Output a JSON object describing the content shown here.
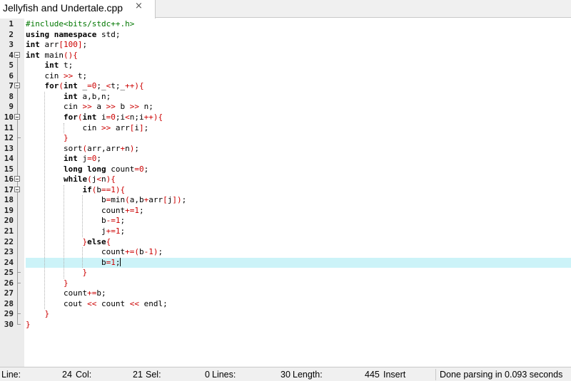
{
  "tab": {
    "title": "Jellyfish and Undertale.cpp",
    "close": "×"
  },
  "editor": {
    "current_line": 24,
    "lines": [
      {
        "n": "1",
        "html": "<span class='pp'>#include&lt;bits/stdc++.h&gt;</span>"
      },
      {
        "n": "2",
        "html": "<span class='kw'>using namespace</span> std;"
      },
      {
        "n": "3",
        "html": "<span class='kw'>int</span> arr<span class='op'>[</span><span class='num'>100</span><span class='op'>]</span>;"
      },
      {
        "n": "4",
        "html": "<span class='kw'>int</span> main<span class='op'>(){</span>"
      },
      {
        "n": "5",
        "html": "    <span class='kw'>int</span> t;"
      },
      {
        "n": "6",
        "html": "    cin <span class='op'>&gt;&gt;</span> t;"
      },
      {
        "n": "7",
        "html": "    <span class='kw'>for</span><span class='op'>(</span><span class='kw'>int</span> _<span class='op'>=</span><span class='num'>0</span>;_<span class='op'>&lt;</span>t;_<span class='op'>++){</span>"
      },
      {
        "n": "8",
        "html": "        <span class='kw'>int</span> a,b,n;"
      },
      {
        "n": "9",
        "html": "        cin <span class='op'>&gt;&gt;</span> a <span class='op'>&gt;&gt;</span> b <span class='op'>&gt;&gt;</span> n;"
      },
      {
        "n": "10",
        "html": "        <span class='kw'>for</span><span class='op'>(</span><span class='kw'>int</span> i<span class='op'>=</span><span class='num'>0</span>;i<span class='op'>&lt;</span>n;i<span class='op'>++){</span>"
      },
      {
        "n": "11",
        "html": "            cin <span class='op'>&gt;&gt;</span> arr<span class='op'>[</span>i<span class='op'>]</span>;"
      },
      {
        "n": "12",
        "html": "        <span class='op'>}</span>"
      },
      {
        "n": "13",
        "html": "        sort<span class='op'>(</span>arr,arr<span class='op'>+</span>n<span class='op'>)</span>;"
      },
      {
        "n": "14",
        "html": "        <span class='kw'>int</span> j<span class='op'>=</span><span class='num'>0</span>;"
      },
      {
        "n": "15",
        "html": "        <span class='kw'>long long</span> count<span class='op'>=</span><span class='num'>0</span>;"
      },
      {
        "n": "16",
        "html": "        <span class='kw'>while</span><span class='op'>(</span>j<span class='op'>&lt;</span>n<span class='op'>){</span>"
      },
      {
        "n": "17",
        "html": "            <span class='kw'>if</span><span class='op'>(</span>b<span class='op'>==</span><span class='num'>1</span><span class='op'>){</span>"
      },
      {
        "n": "18",
        "html": "                b<span class='op'>=</span>min<span class='op'>(</span>a,b<span class='op'>+</span>arr<span class='op'>[</span>j<span class='op'>])</span>;"
      },
      {
        "n": "19",
        "html": "                count<span class='op'>+=</span><span class='num'>1</span>;"
      },
      {
        "n": "20",
        "html": "                b<span class='op'>-=</span><span class='num'>1</span>;"
      },
      {
        "n": "21",
        "html": "                j<span class='op'>+=</span><span class='num'>1</span>;"
      },
      {
        "n": "22",
        "html": "            <span class='op'>}</span><span class='kw'>else</span><span class='op'>{</span>"
      },
      {
        "n": "23",
        "html": "                count<span class='op'>+=(</span>b<span class='op'>-</span><span class='num'>1</span><span class='op'>)</span>;"
      },
      {
        "n": "24",
        "html": "                b<span class='op'>=</span><span class='num'>1</span>;<span class='caret'></span>"
      },
      {
        "n": "25",
        "html": "            <span class='op'>}</span>"
      },
      {
        "n": "26",
        "html": "        <span class='op'>}</span>"
      },
      {
        "n": "27",
        "html": "        count<span class='op'>+=</span>b;"
      },
      {
        "n": "28",
        "html": "        cout <span class='op'>&lt;&lt;</span> count <span class='op'>&lt;&lt;</span> endl;"
      },
      {
        "n": "29",
        "html": "    <span class='op'>}</span>"
      },
      {
        "n": "30",
        "html": "<span class='op'>}</span>"
      }
    ]
  },
  "status": {
    "line_label": "Line:",
    "line_value": "24",
    "col_label": "Col:",
    "col_value": "21",
    "sel_label": "Sel:",
    "sel_value": "0",
    "lines_label": "Lines:",
    "lines_value": "30",
    "length_label": "Length:",
    "length_value": "445",
    "mode": "Insert",
    "message": "Done parsing in 0.093 seconds"
  }
}
